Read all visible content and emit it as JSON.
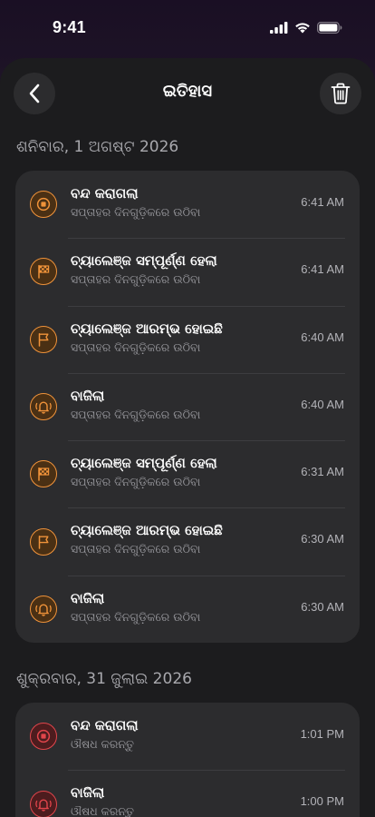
{
  "status_bar": {
    "time": "9:41"
  },
  "header": {
    "title": "ଇତିହାସ",
    "back_icon": "chevron-left-icon",
    "delete_icon": "trash-icon"
  },
  "colors": {
    "accent_orange": "#f0933a",
    "accent_red": "#e2454b",
    "card": "#2c2c2e",
    "sheet": "#1c1c1e"
  },
  "sections": [
    {
      "date": "ଶନିବାର, 1 ଅଗଷ୍ଟ 2026",
      "items": [
        {
          "title": "ବନ୍ଦ କରାଗଲା",
          "subtitle": "ସପ୍ତାହର ଦିନଗୁଡ଼ିକରେ ଉଠିବା",
          "time": "6:41 AM",
          "icon": "stop-icon",
          "color": "orange"
        },
        {
          "title": "ଚ୍ୟାଲେଞ୍ଜ ସମ୍ପୂର୍ଣ୍ଣ ହେଲା",
          "subtitle": "ସପ୍ତାହର ଦିନଗୁଡ଼ିକରେ ଉଠିବା",
          "time": "6:41 AM",
          "icon": "checkered-flag-icon",
          "color": "orange"
        },
        {
          "title": "ଚ୍ୟାଲେଞ୍ଜ ଆରମ୍ଭ ହୋଇଛି",
          "subtitle": "ସପ୍ତାହର ଦିନଗୁଡ଼ିକରେ ଉଠିବା",
          "time": "6:40 AM",
          "icon": "flag-icon",
          "color": "orange"
        },
        {
          "title": "ବାଜିଲା",
          "subtitle": "ସପ୍ତାହର ଦିନଗୁଡ଼ିକରେ ଉଠିବା",
          "time": "6:40 AM",
          "icon": "ringing-bell-icon",
          "color": "orange"
        },
        {
          "title": "ଚ୍ୟାଲେଞ୍ଜ ସମ୍ପୂର୍ଣ୍ଣ ହେଲା",
          "subtitle": "ସପ୍ତାହର ଦିନଗୁଡ଼ିକରେ ଉଠିବା",
          "time": "6:31 AM",
          "icon": "checkered-flag-icon",
          "color": "orange"
        },
        {
          "title": "ଚ୍ୟାଲେଞ୍ଜ ଆରମ୍ଭ ହୋଇଛି",
          "subtitle": "ସପ୍ତାହର ଦିନଗୁଡ଼ିକରେ ଉଠିବା",
          "time": "6:30 AM",
          "icon": "flag-icon",
          "color": "orange"
        },
        {
          "title": "ବାଜିଲା",
          "subtitle": "ସପ୍ତାହର ଦିନଗୁଡ଼ିକରେ ଉଠିବା",
          "time": "6:30 AM",
          "icon": "ringing-bell-icon",
          "color": "orange"
        }
      ]
    },
    {
      "date": "ଶୁକ୍ରବାର, 31 ଜୁଲାଇ 2026",
      "items": [
        {
          "title": "ବନ୍ଦ କରାଗଲା",
          "subtitle": "ଔଷଧ କରନ୍ତୁ",
          "time": "1:01 PM",
          "icon": "stop-icon",
          "color": "red"
        },
        {
          "title": "ବାଜିଲା",
          "subtitle": "ଔଷଧ କରନ୍ତୁ",
          "time": "1:00 PM",
          "icon": "ringing-bell-icon",
          "color": "red"
        }
      ]
    }
  ]
}
